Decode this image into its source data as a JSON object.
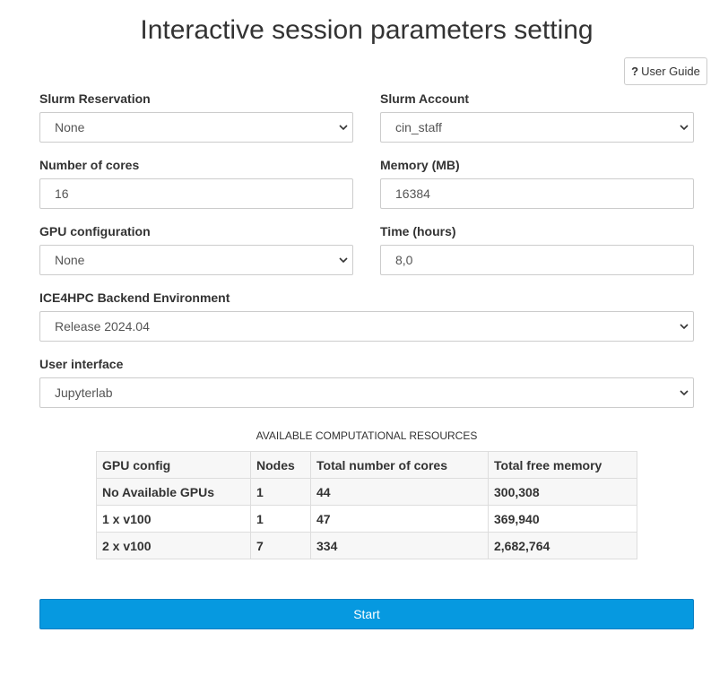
{
  "page": {
    "title": "Interactive session parameters setting",
    "user_guide": {
      "icon": "?",
      "label": "User Guide"
    }
  },
  "form": {
    "slurm_reservation": {
      "label": "Slurm Reservation",
      "value": "None"
    },
    "slurm_account": {
      "label": "Slurm Account",
      "value": "cin_staff"
    },
    "cores": {
      "label": "Number of cores",
      "value": "16"
    },
    "memory": {
      "label": "Memory (MB)",
      "value": "16384"
    },
    "gpu": {
      "label": "GPU configuration",
      "value": "None"
    },
    "time": {
      "label": "Time (hours)",
      "value": "8,0"
    },
    "backend": {
      "label": "ICE4HPC Backend Environment",
      "value": "Release 2024.04"
    },
    "ui": {
      "label": "User interface",
      "value": "Jupyterlab"
    }
  },
  "resources": {
    "caption": "AVAILABLE COMPUTATIONAL RESOURCES",
    "headers": [
      "GPU config",
      "Nodes",
      "Total number of cores",
      "Total free memory"
    ],
    "rows": [
      [
        "No Available GPUs",
        "1",
        "44",
        "300,308"
      ],
      [
        "1 x v100",
        "1",
        "47",
        "369,940"
      ],
      [
        "2 x v100",
        "7",
        "334",
        "2,682,764"
      ]
    ]
  },
  "actions": {
    "start_label": "Start"
  },
  "colors": {
    "primary": "#0699e0",
    "border": "#cccccc"
  }
}
